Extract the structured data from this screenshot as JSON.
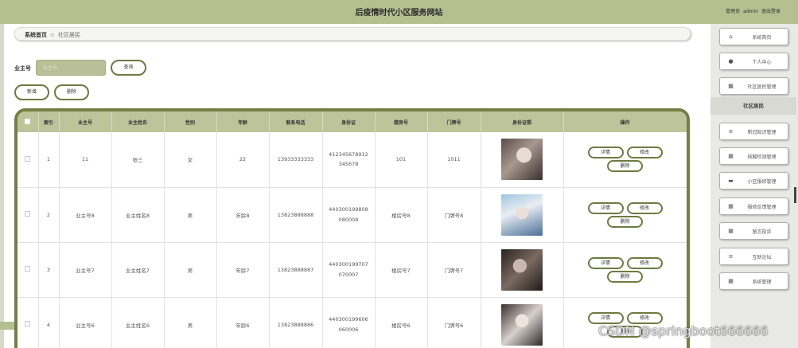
{
  "header": {
    "title": "后疫情时代小区服务网站",
    "role_label": "管理员",
    "username": "admin",
    "logout_label": "退出登录"
  },
  "breadcrumb": {
    "home": "系统首页",
    "separator": "≡",
    "current": "社区居民"
  },
  "search": {
    "label": "业主号",
    "placeholder": "业主号",
    "button_label": "查询"
  },
  "toolbar": {
    "add_label": "新增",
    "delete_label": "删除"
  },
  "table": {
    "columns": [
      "",
      "索引",
      "业主号",
      "业主姓名",
      "性别",
      "年龄",
      "联系电话",
      "身份证",
      "楼房号",
      "门牌号",
      "身份证照",
      "操作"
    ],
    "rows": [
      {
        "index": "1",
        "owner_no": "11",
        "owner_name": "张三",
        "gender": "女",
        "age": "22",
        "phone": "13933333333",
        "id_line1": "412345678912",
        "id_line2": "345678",
        "building": "101",
        "door": "1011"
      },
      {
        "index": "2",
        "owner_no": "业主号8",
        "owner_name": "业主姓名8",
        "gender": "男",
        "age": "年龄8",
        "phone": "13823888888",
        "id_line1": "440300199808",
        "id_line2": "080008",
        "building": "楼房号8",
        "door": "门牌号8"
      },
      {
        "index": "3",
        "owner_no": "业主号7",
        "owner_name": "业主姓名7",
        "gender": "男",
        "age": "年龄7",
        "phone": "13823888887",
        "id_line1": "440300199707",
        "id_line2": "070007",
        "building": "楼房号7",
        "door": "门牌号7"
      },
      {
        "index": "4",
        "owner_no": "业主号6",
        "owner_name": "业主姓名6",
        "gender": "男",
        "age": "年龄6",
        "phone": "13823888886",
        "id_line1": "440300199606",
        "id_line2": "060006",
        "building": "楼房号6",
        "door": "门牌号6"
      }
    ],
    "actions": {
      "detail": "详情",
      "edit": "修改",
      "delete": "删除"
    }
  },
  "sidebar": {
    "items": [
      {
        "label": "系统首页",
        "icon": "home-icon"
      },
      {
        "label": "个人中心",
        "icon": "user-icon"
      },
      {
        "label": "社区居民管理",
        "icon": "chart-icon"
      },
      {
        "label": "社区居民",
        "icon": ""
      },
      {
        "label": "新冠知识管理",
        "icon": "list-icon"
      },
      {
        "label": "核酸检测管理",
        "icon": "grid-icon"
      },
      {
        "label": "小区报修管理",
        "icon": "ticket-icon"
      },
      {
        "label": "报修反馈管理",
        "icon": "grid-icon"
      },
      {
        "label": "留言投诉",
        "icon": "grid-icon"
      },
      {
        "label": "互助论坛",
        "icon": "sliders-icon"
      },
      {
        "label": "系统管理",
        "icon": "grid-icon"
      }
    ]
  },
  "watermark": "CSDN @springboot666666",
  "colors": {
    "header_bg": "#b6bf8f",
    "accent": "#747f44",
    "table_header": "#bdc49a"
  }
}
